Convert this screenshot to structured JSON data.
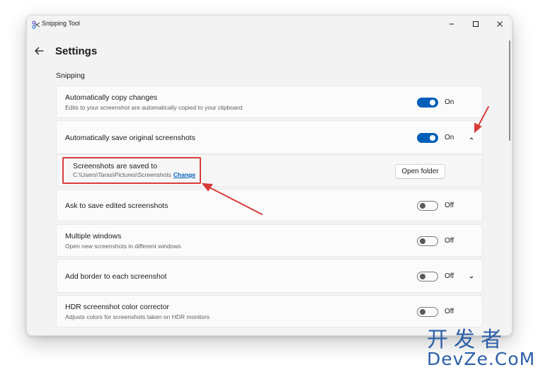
{
  "window": {
    "title": "Snipping Tool"
  },
  "page": {
    "title": "Settings",
    "section": "Snipping"
  },
  "settings": [
    {
      "label": "Automatically copy changes",
      "description": "Edits to your screenshot are automatically copied to your clipboard",
      "state": "On"
    },
    {
      "label": "Automatically save original screenshots",
      "state": "On"
    },
    {
      "label": "Ask to save edited screenshots",
      "state": "Off"
    },
    {
      "label": "Multiple windows",
      "description": "Open new screenshots in different windows",
      "state": "Off"
    },
    {
      "label": "Add border to each screenshot",
      "state": "Off"
    },
    {
      "label": "HDR screenshot color corrector",
      "description": "Adjusts colors for screenshots taken on HDR monitors",
      "state": "Off"
    }
  ],
  "save_location": {
    "label": "Screenshots are saved to",
    "path": "C:\\Users\\Taras\\Pictures\\Screenshots",
    "change_link": "Change",
    "open_button": "Open folder"
  },
  "icons": [
    "snipping-tool-icon",
    "minimize-icon",
    "maximize-icon",
    "close-icon",
    "back-arrow-icon",
    "chevron-up-icon",
    "chevron-down-icon"
  ],
  "colors": {
    "accent": "#005fb8",
    "annotation": "#d93b3b",
    "watermark": "#2c5fa8"
  },
  "watermark": {
    "line1": "开发者",
    "line2": "DevZe.CoM"
  }
}
